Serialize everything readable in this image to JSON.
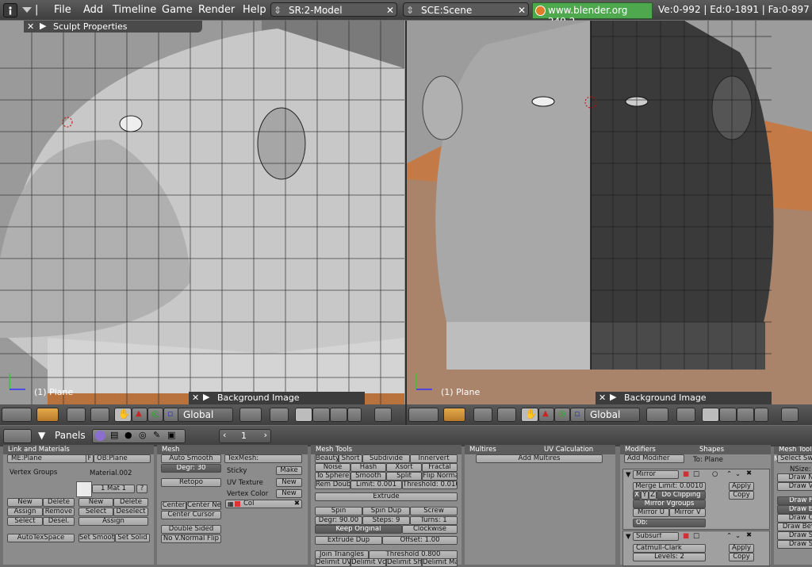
{
  "menu": {
    "items": [
      "File",
      "Add",
      "Timeline",
      "Game",
      "Render",
      "Help"
    ]
  },
  "screen_field": {
    "value": "SR:2-Model"
  },
  "scene_field": {
    "value": "SCE:Scene"
  },
  "site_text": "www.blender.org 249.2",
  "stats": "Ve:0-992 | Ed:0-1891 | Fa:0-897",
  "sculpt_label": "Sculpt Properties",
  "left_view": {
    "object_label": "(1) Plane",
    "bg_label": "Background Image",
    "orientation": "Global"
  },
  "right_view": {
    "object_label": "(1) Plane",
    "bg_label": "Background Image",
    "orientation": "Global"
  },
  "panels_header": {
    "label": "Panels",
    "page": "1"
  },
  "link_materials": {
    "title": "Link and Materials",
    "me": "ME:Plane",
    "f": "F",
    "ob": "OB:Plane",
    "vertex_groups": "Vertex Groups",
    "material": "Material.002",
    "mat_slot": "1 Mat 1",
    "q": "?",
    "buttons_left": [
      "New",
      "Delete",
      "Assign",
      "Remove",
      "Select",
      "Desel."
    ],
    "buttons_right": [
      "New",
      "Delete",
      "Select",
      "Deselect",
      "Assign"
    ],
    "autotex": "AutoTexSpace",
    "set_smooth": "Set Smoot",
    "set_solid": "Set Solid"
  },
  "mesh": {
    "title": "Mesh",
    "auto_smooth": "Auto Smooth",
    "degr": "Degr: 30",
    "retopo": "Retopo",
    "texmesh": "TexMesh:",
    "sticky": "Sticky",
    "make": "Make",
    "uv_texture": "UV Texture",
    "new1": "New",
    "vertex_color": "Vertex Color",
    "new2": "New",
    "col": "Col",
    "center": "Center",
    "center_new": "Center New",
    "center_cursor": "Center Cursor",
    "double_sided": "Double Sided",
    "no_vnormal": "No V.Normal Flip"
  },
  "mesh_tools": {
    "title": "Mesh Tools",
    "row1": [
      "Beauty",
      "Short",
      "Subdivide",
      "Innervert"
    ],
    "row2": [
      "Noise",
      "Hash",
      "Xsort",
      "Fractal"
    ],
    "row3": [
      "To Sphere",
      "Smooth",
      "Split",
      "Flip Normal"
    ],
    "row4": [
      "Rem Doubl",
      "Limit: 0.001",
      "Threshold: 0.010"
    ],
    "extrude": "Extrude",
    "spin_row": [
      "Spin",
      "Spin Dup",
      "Screw"
    ],
    "degr_row": [
      "Degr: 90.00",
      "Steps: 9",
      "Turns: 1"
    ],
    "keep_original": "Keep Original",
    "clockwise": "Clockwise",
    "extrude_dup": "Extrude Dup",
    "offset": "Offset: 1.00",
    "join_triangles": "Join Triangles",
    "threshold": "Threshold 0.800",
    "delimit": [
      "Delimit UV",
      "Delimit Vco",
      "Delimit Sha",
      "Delimit Ma"
    ]
  },
  "multires": {
    "title": "Multires",
    "uv_title": "UV Calculation",
    "add": "Add Multires"
  },
  "modifiers": {
    "tab1": "Modifiers",
    "tab2": "Shapes",
    "add_modifier": "Add Modifier",
    "to": "To: Plane",
    "mirror": "Mirror",
    "merge_limit": "Merge Limit: 0.0010",
    "x": "X",
    "y": "Y",
    "z": "Z",
    "do_clipping": "Do Clipping",
    "mirror_vgroups": "Mirror Vgroups",
    "mirror_u": "Mirror U",
    "mirror_v": "Mirror V",
    "ob": "Ob:",
    "apply1": "Apply",
    "copy1": "Copy",
    "subsurf": "Subsurf",
    "catmull": "Catmull-Clark",
    "levels": "Levels: 2",
    "apply2": "Apply",
    "copy2": "Copy"
  },
  "mesh_tools_more": {
    "title": "Mesh Tools More",
    "select_swap": "Select Swap",
    "nsize": "NSize:",
    "draw_n": "Draw N",
    "draw_v": "Draw V",
    "items": [
      "Draw F",
      "Draw E",
      "Draw C",
      "Draw Beve",
      "Draw S",
      "Draw S"
    ]
  },
  "colors": {
    "accent": "#4ea84e",
    "orange": "#c8733d",
    "panel": "#8c8c8c"
  }
}
